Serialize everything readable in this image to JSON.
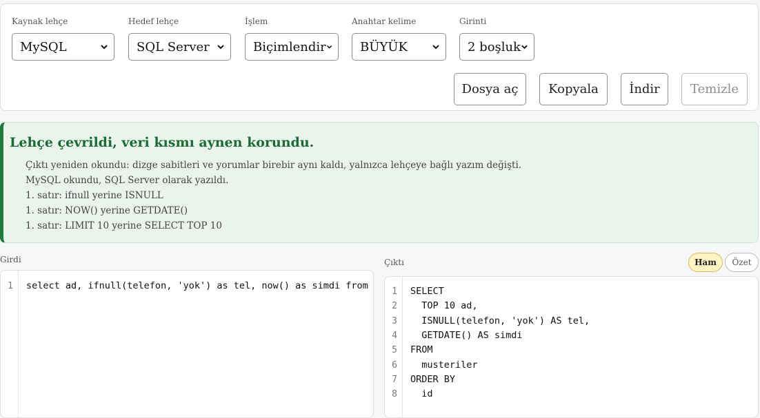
{
  "toolbar": {
    "fields": [
      {
        "label": "Kaynak lehçe",
        "value": "MySQL"
      },
      {
        "label": "Hedef lehçe",
        "value": "SQL Server"
      },
      {
        "label": "İşlem",
        "value": "Biçimlendir"
      },
      {
        "label": "Anahtar kelime",
        "value": "BÜYÜK"
      },
      {
        "label": "Girinti",
        "value": "2 boşluk"
      }
    ],
    "buttons": {
      "open_file": "Dosya aç",
      "copy": "Kopyala",
      "download": "İndir",
      "clear": "Temizle"
    }
  },
  "notice": {
    "title": "Lehçe çevrildi, veri kısmı aynen korundu.",
    "items": [
      "Çıktı yeniden okundu: dizge sabitleri ve yorumlar birebir aynı kaldı, yalnızca lehçeye bağlı yazım değişti.",
      "MySQL okundu, SQL Server olarak yazıldı.",
      "1. satır: ifnull yerine ISNULL",
      "1. satır: NOW() yerine GETDATE()",
      "1. satır: LIMIT 10 yerine SELECT TOP 10"
    ]
  },
  "input": {
    "label": "Girdi",
    "line_numbers": [
      "1"
    ],
    "lines": [
      "select ad, ifnull(telefon, 'yok') as tel, now() as simdi from m"
    ]
  },
  "output": {
    "label": "Çıktı",
    "toggle_raw": "Ham",
    "toggle_summary": "Özet",
    "line_numbers": [
      "1",
      "2",
      "3",
      "4",
      "5",
      "6",
      "7",
      "8"
    ],
    "lines": [
      "SELECT",
      "  TOP 10 ad,",
      "  ISNULL(telefon, 'yok') AS tel,",
      "  GETDATE() AS simdi",
      "FROM",
      "  musteriler",
      "ORDER BY",
      "  id"
    ]
  },
  "colors": {
    "notice_accent": "#1e7a3c",
    "notice_bg": "#eaf4ec",
    "toggle_active_bg": "#fdf3c4"
  },
  "icons": {
    "select_arrow": "chevron-down-icon"
  }
}
